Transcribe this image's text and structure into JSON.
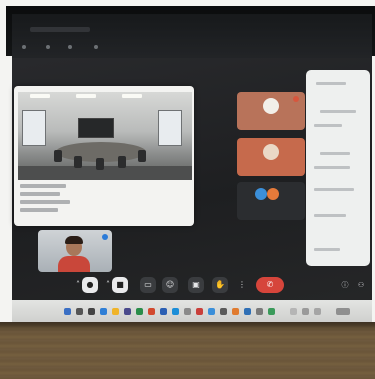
{
  "scene": {
    "description_visible_text_only": true
  },
  "topbar": {
    "items": [
      "",
      "",
      "",
      ""
    ]
  },
  "participants": [
    {
      "name": "",
      "avatar_color": "#f2efe9",
      "tile_color": "#b8735a"
    },
    {
      "name": "",
      "avatar_color": "#ead8c6",
      "tile_color": "#c66a4c"
    },
    {
      "name": "",
      "avatar_color": "#3b8fd9",
      "tile_color": "#2b2d30"
    }
  ],
  "controls": {
    "icons": [
      "chevron-up-icon",
      "mic-icon",
      "chevron-up-icon",
      "camera-icon",
      "captions-icon",
      "emoji-icon",
      "present-icon",
      "raise-hand-icon",
      "more-icon",
      "end-call-icon"
    ],
    "end_call_color": "#d6453b"
  },
  "colors": {
    "screen_bg": "#1e1f21",
    "panel_bg": "#eef0ef",
    "desk": "#6f5a3f"
  }
}
